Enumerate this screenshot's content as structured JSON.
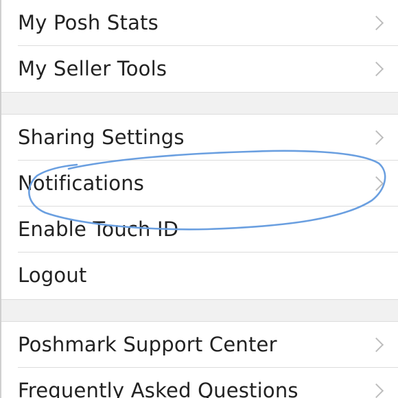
{
  "menu": {
    "group1": [
      {
        "label": "My Posh Stats",
        "chevron": true
      },
      {
        "label": "My Seller Tools",
        "chevron": true
      }
    ],
    "group2": [
      {
        "label": "Sharing Settings",
        "chevron": true
      },
      {
        "label": "Notifications",
        "chevron": true
      },
      {
        "label": "Enable Touch ID",
        "chevron": false
      },
      {
        "label": "Logout",
        "chevron": false
      }
    ],
    "group3": [
      {
        "label": "Poshmark Support Center",
        "chevron": true
      },
      {
        "label": "Frequently Asked Questions",
        "chevron": true
      }
    ]
  },
  "annotation": {
    "shape": "hand-drawn-ellipse",
    "highlights": "Notifications",
    "color": "#6a9fe0"
  },
  "colors": {
    "text": "#222222",
    "divider": "#dcdcdc",
    "section_background": "#f1f1f1",
    "chevron": "#bdbdbd"
  }
}
